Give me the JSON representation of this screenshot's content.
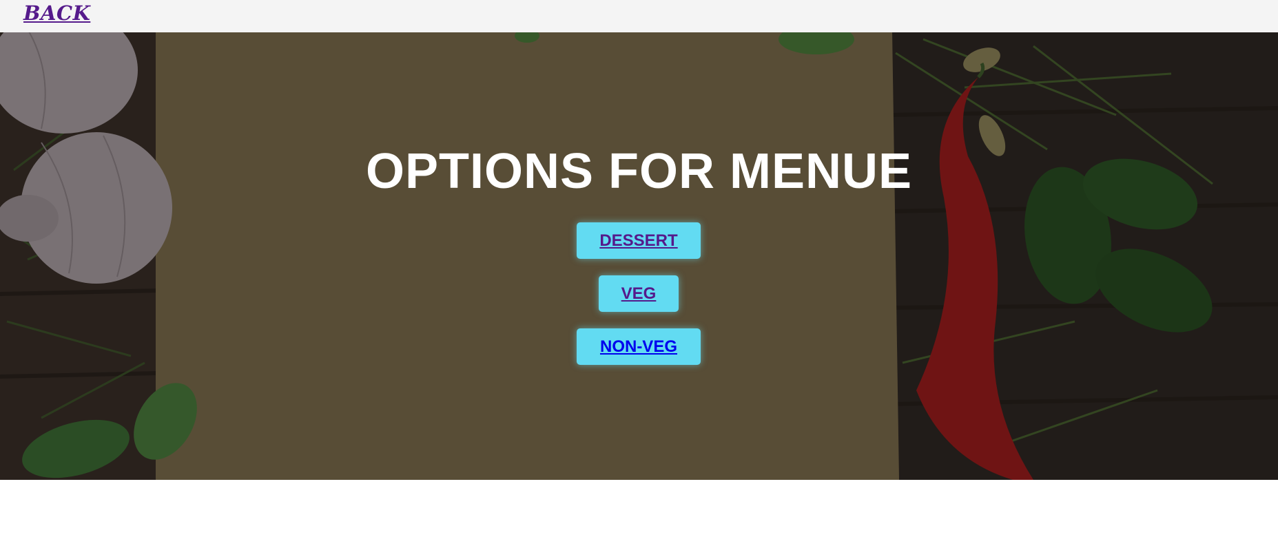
{
  "nav": {
    "back_label": "BACK"
  },
  "hero": {
    "title": "OPTIONS FOR MENUE",
    "options": [
      {
        "label": "DESSERT"
      },
      {
        "label": "VEG"
      },
      {
        "label": "NON-VEG"
      }
    ]
  },
  "colors": {
    "topbar_bg": "#f4f4f4",
    "button_bg": "#62dbf2",
    "visited_link": "#551a8b",
    "link": "#0000ee",
    "title_text": "#ffffff"
  }
}
